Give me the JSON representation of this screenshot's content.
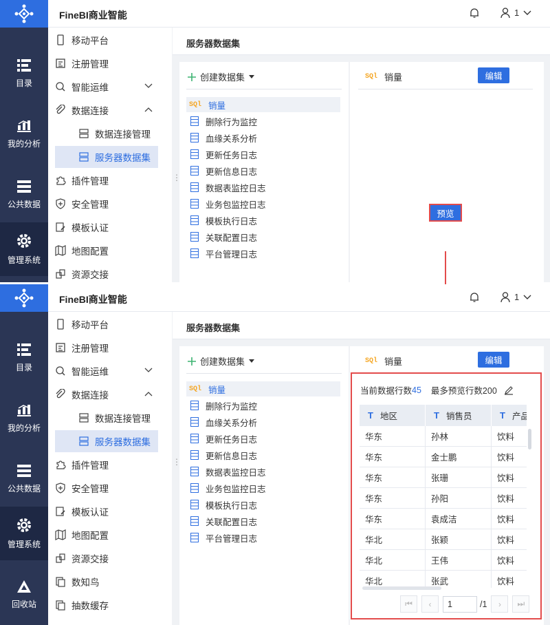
{
  "app": {
    "title": "FineBI商业智能",
    "user": "1"
  },
  "rail": [
    {
      "label": "目录",
      "icon": "catalog-icon"
    },
    {
      "label": "我的分析",
      "icon": "analysis-icon"
    },
    {
      "label": "公共数据",
      "icon": "public-data-icon"
    },
    {
      "label": "管理系统",
      "icon": "gear-icon"
    },
    {
      "label": "回收站",
      "icon": "recycle-icon"
    }
  ],
  "nav": {
    "mobile": "移动平台",
    "register": "注册管理",
    "ops": "智能运维",
    "dataconn": "数据连接",
    "connmgr": "数据连接管理",
    "serverds": "服务器数据集",
    "plugins": "插件管理",
    "security": "安全管理",
    "template_auth": "模板认证",
    "map": "地图配置",
    "resource": "资源交接",
    "zhiniao": "数知鸟",
    "cache": "抽数缓存"
  },
  "breadcrumb": "服务器数据集",
  "create_dataset": "创建数据集",
  "datasets": [
    "销量",
    "删除行为监控",
    "血缘关系分析",
    "更新任务日志",
    "更新信息日志",
    "数据表监控日志",
    "业务包监控日志",
    "模板执行日志",
    "关联配置日志",
    "平台管理日志"
  ],
  "preview_panel": {
    "dataset_name": "销量",
    "sql_badge": "SQl",
    "edit_label": "编辑",
    "preview_label": "预览",
    "row_count_label": "当前数据行数",
    "row_count": "45",
    "max_rows_label": "最多预览行数200",
    "columns": [
      "地区",
      "销售员",
      "产品"
    ],
    "rows": [
      [
        "华东",
        "孙林",
        "饮料"
      ],
      [
        "华东",
        "金士鹏",
        "饮料"
      ],
      [
        "华东",
        "张珊",
        "饮料"
      ],
      [
        "华东",
        "孙阳",
        "饮料"
      ],
      [
        "华东",
        "袁成洁",
        "饮料"
      ],
      [
        "华北",
        "张颖",
        "饮料"
      ],
      [
        "华北",
        "王伟",
        "饮料"
      ],
      [
        "华北",
        "张武",
        "饮料"
      ]
    ],
    "page": "1",
    "total_pages": "/1"
  }
}
